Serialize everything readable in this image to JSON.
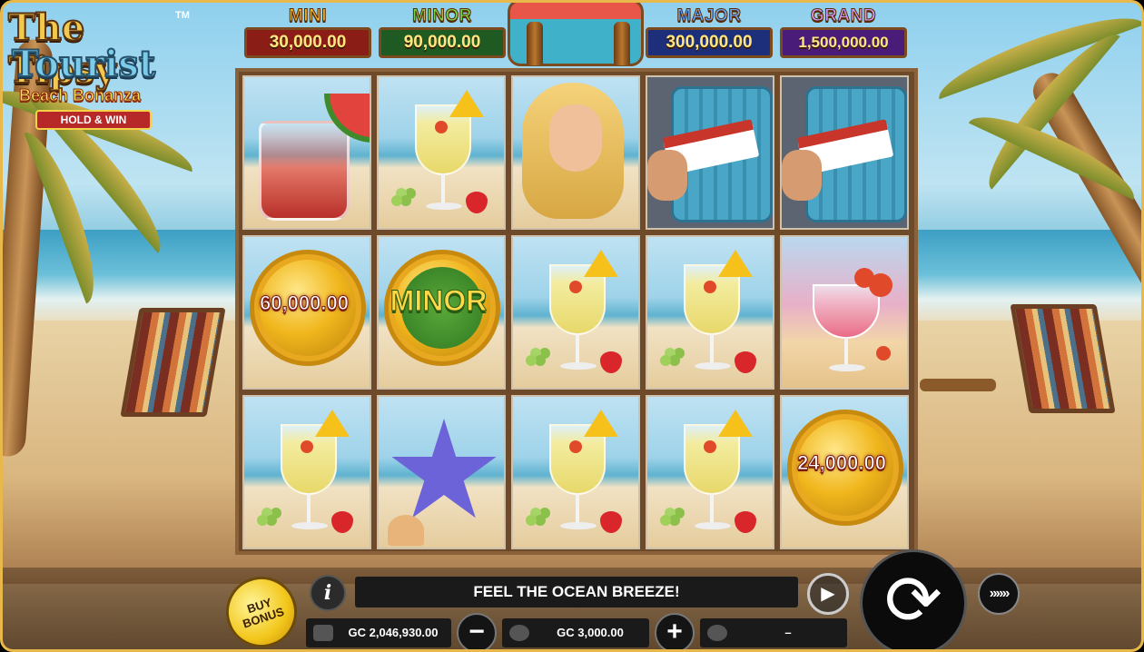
{
  "logo": {
    "line1": "The Tipsy",
    "tm": "TM",
    "line2": "Tourist",
    "line3": "Beach Bonanza",
    "badge": "HOLD & WIN"
  },
  "jackpots": [
    {
      "label": "MINI",
      "value": "30,000.00",
      "color": "#f2b233",
      "box": "#8a1e16"
    },
    {
      "label": "MINOR",
      "value": "90,000.00",
      "color": "#7fd34a",
      "box": "#1f5a22"
    },
    {
      "label": "MAJOR",
      "value": "300,000.00",
      "color": "#6aa8ff",
      "box": "#1d2f7a"
    },
    {
      "label": "GRAND",
      "value": "1,500,000.00",
      "color": "#d09bff",
      "box": "#4a1c7a"
    }
  ],
  "reels": {
    "rows": [
      [
        "red-cocktail",
        "pina-colada",
        "tourist-girl",
        "suitcase-ticket",
        "suitcase-ticket"
      ],
      [
        "coin-value",
        "coin-minor",
        "pina-colada",
        "pina-colada",
        "cherry-cocktail"
      ],
      [
        "pina-colada",
        "starfish",
        "pina-colada",
        "pina-colada",
        "coin-value"
      ]
    ],
    "coin_values": {
      "r1c0": "60,000.00",
      "r2c4": "24,000.00"
    },
    "coin_minor_label": "MINOR"
  },
  "controls": {
    "buy_bonus_label": "BUY BONUS",
    "info_label": "i",
    "message": "FEEL THE OCEAN BREEZE!",
    "balance": "GC 2,046,930.00",
    "bet": "GC 3,000.00",
    "win": "–",
    "minus_label": "−",
    "plus_label": "+",
    "spin_icon": "⟳",
    "autoplay_icon": "▶",
    "turbo_icon": "»»»"
  }
}
